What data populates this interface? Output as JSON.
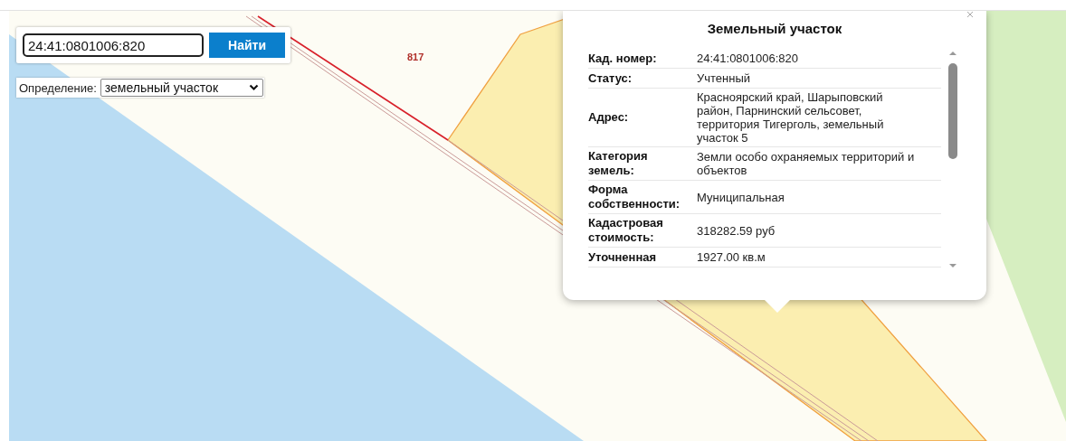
{
  "search": {
    "value": "24:41:0801006:820",
    "button": "Найти"
  },
  "mode": {
    "label": "Определение:",
    "value": "земельный участок"
  },
  "map": {
    "labels": [
      "817"
    ]
  },
  "popup": {
    "title": "Земельный участок",
    "rows": [
      {
        "label": "Кад. номер:",
        "value": "24:41:0801006:820"
      },
      {
        "label": "Статус:",
        "value": "Учтенный"
      },
      {
        "label": "Адрес:",
        "value": "Красноярский край, Шарыповский район, Парнинский сельсовет, территория Тигерголь, земельный участок 5"
      },
      {
        "label": "Категория земель:",
        "value": "Земли особо охраняемых территорий и объектов"
      },
      {
        "label": "Форма собственности:",
        "value": "Муниципальная"
      },
      {
        "label": "Кадастровая стоимость:",
        "value": "318282.59 руб"
      },
      {
        "label": "Уточненная",
        "value": "1927.00 кв.м"
      }
    ]
  }
}
